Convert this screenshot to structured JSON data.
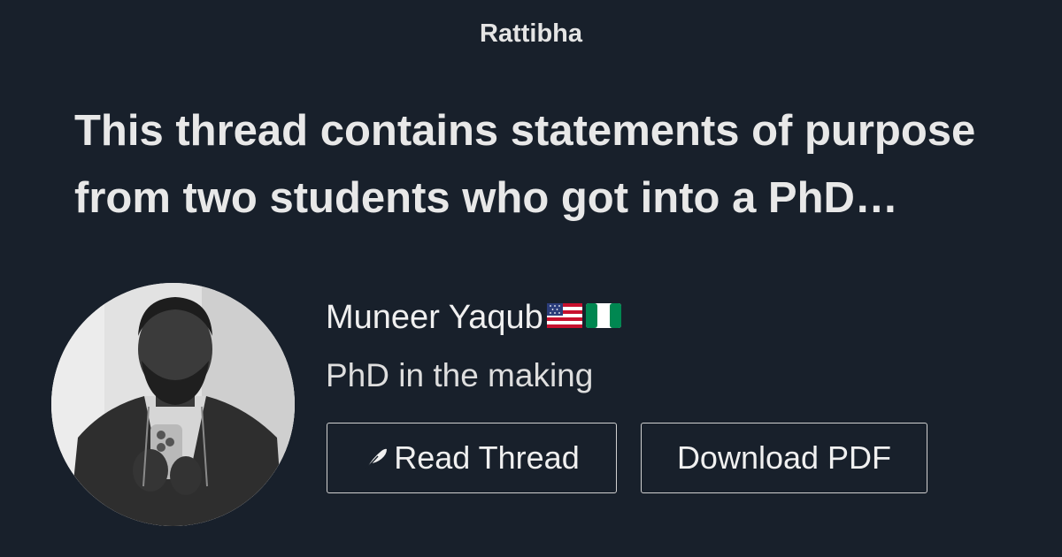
{
  "header": {
    "brand": "Rattibha"
  },
  "thread": {
    "title": "This thread contains statements of purpose from two students who got into a PhD…"
  },
  "author": {
    "name": "Muneer Yaqub",
    "flags": [
      "us-flag-icon",
      "nigeria-flag-icon"
    ],
    "bio": "PhD in the making"
  },
  "actions": {
    "read_label": "Read Thread",
    "read_icon": "feather-icon",
    "pdf_label": "Download PDF"
  },
  "colors": {
    "background": "#18202b",
    "text": "#e6e6e6",
    "button_border": "#d0d0d0"
  }
}
